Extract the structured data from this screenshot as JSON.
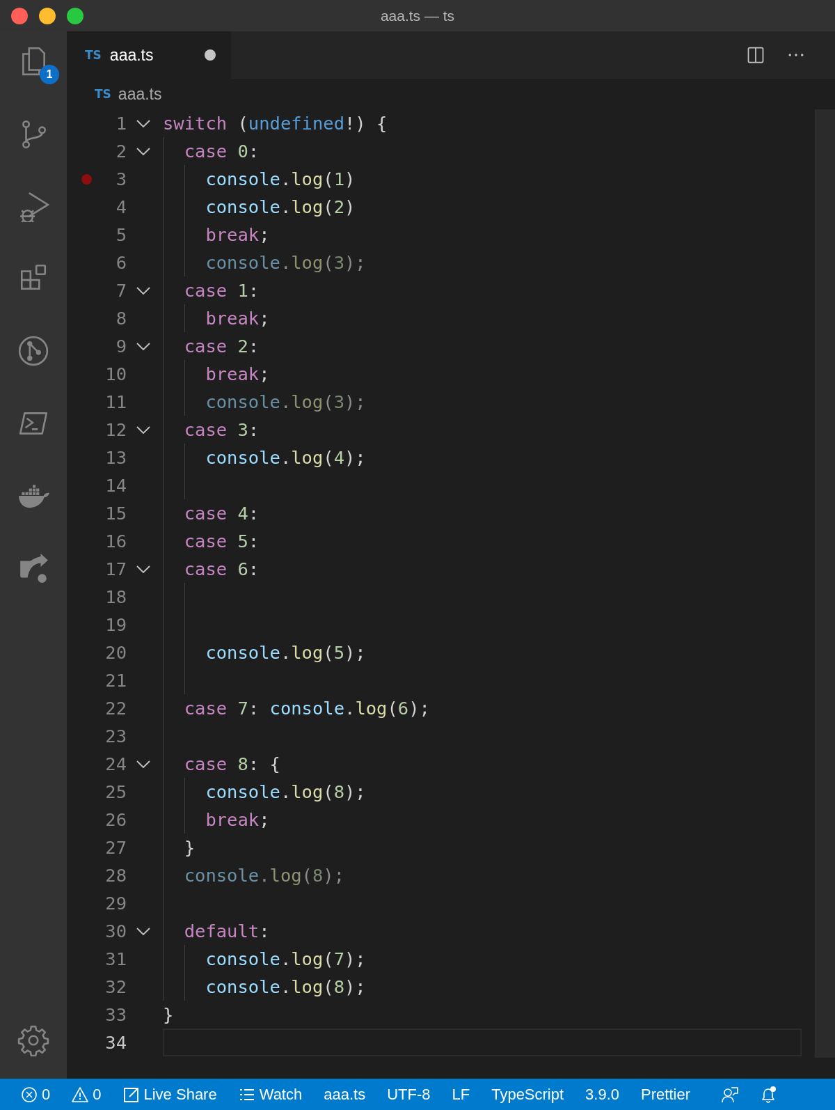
{
  "window": {
    "title": "aaa.ts — ts"
  },
  "activity_bar": {
    "items": [
      {
        "kind": "explorer",
        "badge": "1"
      },
      {
        "kind": "source-control"
      },
      {
        "kind": "run-debug"
      },
      {
        "kind": "extensions"
      },
      {
        "kind": "git-graph"
      },
      {
        "kind": "terminal"
      },
      {
        "kind": "docker"
      },
      {
        "kind": "share"
      }
    ],
    "bottom": [
      {
        "kind": "settings"
      }
    ]
  },
  "tabs": [
    {
      "type_label": "TS",
      "label": "aaa.ts",
      "selected": true,
      "dirty": true
    }
  ],
  "breadcrumb": {
    "type_label": "TS",
    "file": "aaa.ts"
  },
  "editor": {
    "lines": [
      {
        "number": "1",
        "breakpoint": false,
        "faded": false,
        "current": false,
        "tokens": [
          {
            "kind": "kw",
            "text": "switch"
          },
          {
            "kind": "p",
            "text": " ("
          },
          {
            "kind": "const",
            "text": "undefined"
          },
          {
            "kind": "p",
            "text": "!) {"
          }
        ],
        "children": [
          {
            "number": "2",
            "breakpoint": false,
            "faded": false,
            "current": false,
            "tokens": [
              {
                "kind": "kw",
                "text": "case"
              },
              {
                "kind": "num",
                "text": " 0"
              },
              {
                "kind": "p",
                "text": ":"
              }
            ],
            "children": [
              {
                "number": "3",
                "breakpoint": true,
                "faded": false,
                "current": false,
                "tokens": [
                  {
                    "kind": "var",
                    "text": "console"
                  },
                  {
                    "kind": "p",
                    "text": "."
                  },
                  {
                    "kind": "fn",
                    "text": "log"
                  },
                  {
                    "kind": "p",
                    "text": "("
                  },
                  {
                    "kind": "num",
                    "text": "1"
                  },
                  {
                    "kind": "p",
                    "text": ")"
                  }
                ]
              },
              {
                "number": "4",
                "breakpoint": false,
                "faded": false,
                "current": false,
                "tokens": [
                  {
                    "kind": "var",
                    "text": "console"
                  },
                  {
                    "kind": "p",
                    "text": "."
                  },
                  {
                    "kind": "fn",
                    "text": "log"
                  },
                  {
                    "kind": "p",
                    "text": "("
                  },
                  {
                    "kind": "num",
                    "text": "2"
                  },
                  {
                    "kind": "p",
                    "text": ")"
                  }
                ]
              },
              {
                "number": "5",
                "breakpoint": false,
                "faded": false,
                "current": false,
                "tokens": [
                  {
                    "kind": "kw",
                    "text": "break"
                  },
                  {
                    "kind": "p",
                    "text": ";"
                  }
                ]
              },
              {
                "number": "6",
                "breakpoint": false,
                "faded": true,
                "current": false,
                "tokens": [
                  {
                    "kind": "var",
                    "text": "console"
                  },
                  {
                    "kind": "p",
                    "text": "."
                  },
                  {
                    "kind": "fn",
                    "text": "log"
                  },
                  {
                    "kind": "p",
                    "text": "("
                  },
                  {
                    "kind": "num",
                    "text": "3"
                  },
                  {
                    "kind": "p",
                    "text": ");"
                  }
                ]
              }
            ]
          },
          {
            "number": "7",
            "breakpoint": false,
            "faded": false,
            "current": false,
            "tokens": [
              {
                "kind": "kw",
                "text": "case"
              },
              {
                "kind": "num",
                "text": " 1"
              },
              {
                "kind": "p",
                "text": ":"
              }
            ],
            "children": [
              {
                "number": "8",
                "breakpoint": false,
                "faded": false,
                "current": false,
                "tokens": [
                  {
                    "kind": "kw",
                    "text": "break"
                  },
                  {
                    "kind": "p",
                    "text": ";"
                  }
                ]
              }
            ]
          },
          {
            "number": "9",
            "breakpoint": false,
            "faded": false,
            "current": false,
            "tokens": [
              {
                "kind": "kw",
                "text": "case"
              },
              {
                "kind": "num",
                "text": " 2"
              },
              {
                "kind": "p",
                "text": ":"
              }
            ],
            "children": [
              {
                "number": "10",
                "breakpoint": false,
                "faded": false,
                "current": false,
                "tokens": [
                  {
                    "kind": "kw",
                    "text": "break"
                  },
                  {
                    "kind": "p",
                    "text": ";"
                  }
                ]
              },
              {
                "number": "11",
                "breakpoint": false,
                "faded": true,
                "current": false,
                "tokens": [
                  {
                    "kind": "var",
                    "text": "console"
                  },
                  {
                    "kind": "p",
                    "text": "."
                  },
                  {
                    "kind": "fn",
                    "text": "log"
                  },
                  {
                    "kind": "p",
                    "text": "("
                  },
                  {
                    "kind": "num",
                    "text": "3"
                  },
                  {
                    "kind": "p",
                    "text": ");"
                  }
                ]
              }
            ]
          },
          {
            "number": "12",
            "breakpoint": false,
            "faded": false,
            "current": false,
            "tokens": [
              {
                "kind": "kw",
                "text": "case"
              },
              {
                "kind": "num",
                "text": " 3"
              },
              {
                "kind": "p",
                "text": ":"
              }
            ],
            "children": [
              {
                "number": "13",
                "breakpoint": false,
                "faded": false,
                "current": false,
                "tokens": [
                  {
                    "kind": "var",
                    "text": "console"
                  },
                  {
                    "kind": "p",
                    "text": "."
                  },
                  {
                    "kind": "fn",
                    "text": "log"
                  },
                  {
                    "kind": "p",
                    "text": "("
                  },
                  {
                    "kind": "num",
                    "text": "4"
                  },
                  {
                    "kind": "p",
                    "text": ");"
                  }
                ]
              },
              {
                "number": "14",
                "breakpoint": false,
                "current": false
              }
            ]
          },
          {
            "number": "15",
            "breakpoint": false,
            "faded": false,
            "current": false,
            "tokens": [
              {
                "kind": "kw",
                "text": "case"
              },
              {
                "kind": "num",
                "text": " 4"
              },
              {
                "kind": "p",
                "text": ":"
              }
            ]
          },
          {
            "number": "16",
            "breakpoint": false,
            "faded": false,
            "current": false,
            "tokens": [
              {
                "kind": "kw",
                "text": "case"
              },
              {
                "kind": "num",
                "text": " 5"
              },
              {
                "kind": "p",
                "text": ":"
              }
            ]
          },
          {
            "number": "17",
            "breakpoint": false,
            "faded": false,
            "current": false,
            "tokens": [
              {
                "kind": "kw",
                "text": "case"
              },
              {
                "kind": "num",
                "text": " 6"
              },
              {
                "kind": "p",
                "text": ":"
              }
            ],
            "children": [
              {
                "number": "18",
                "breakpoint": false,
                "current": false
              },
              {
                "number": "19",
                "breakpoint": false,
                "current": false
              },
              {
                "number": "20",
                "breakpoint": false,
                "faded": false,
                "current": false,
                "tokens": [
                  {
                    "kind": "var",
                    "text": "console"
                  },
                  {
                    "kind": "p",
                    "text": "."
                  },
                  {
                    "kind": "fn",
                    "text": "log"
                  },
                  {
                    "kind": "p",
                    "text": "("
                  },
                  {
                    "kind": "num",
                    "text": "5"
                  },
                  {
                    "kind": "p",
                    "text": ");"
                  }
                ]
              },
              {
                "number": "21",
                "breakpoint": false,
                "current": false
              }
            ]
          },
          {
            "number": "22",
            "breakpoint": false,
            "faded": false,
            "current": false,
            "tokens": [
              {
                "kind": "kw",
                "text": "case"
              },
              {
                "kind": "num",
                "text": " 7"
              },
              {
                "kind": "p",
                "text": ": "
              },
              {
                "kind": "var",
                "text": "console"
              },
              {
                "kind": "p",
                "text": "."
              },
              {
                "kind": "fn",
                "text": "log"
              },
              {
                "kind": "p",
                "text": "("
              },
              {
                "kind": "num",
                "text": "6"
              },
              {
                "kind": "p",
                "text": ");"
              }
            ]
          },
          {
            "number": "23",
            "breakpoint": false,
            "current": false
          },
          {
            "number": "24",
            "breakpoint": false,
            "faded": false,
            "current": false,
            "tokens": [
              {
                "kind": "kw",
                "text": "case"
              },
              {
                "kind": "num",
                "text": " 8"
              },
              {
                "kind": "p",
                "text": ": {"
              }
            ],
            "children": [
              {
                "number": "25",
                "breakpoint": false,
                "faded": false,
                "current": false,
                "tokens": [
                  {
                    "kind": "var",
                    "text": "console"
                  },
                  {
                    "kind": "p",
                    "text": "."
                  },
                  {
                    "kind": "fn",
                    "text": "log"
                  },
                  {
                    "kind": "p",
                    "text": "("
                  },
                  {
                    "kind": "num",
                    "text": "8"
                  },
                  {
                    "kind": "p",
                    "text": ");"
                  }
                ]
              },
              {
                "number": "26",
                "breakpoint": false,
                "faded": false,
                "current": false,
                "tokens": [
                  {
                    "kind": "kw",
                    "text": "break"
                  },
                  {
                    "kind": "p",
                    "text": ";"
                  }
                ]
              }
            ]
          },
          {
            "number": "27",
            "breakpoint": false,
            "faded": false,
            "current": false,
            "tokens": [
              {
                "kind": "p",
                "text": "}"
              }
            ]
          },
          {
            "number": "28",
            "breakpoint": false,
            "faded": true,
            "current": false,
            "tokens": [
              {
                "kind": "var",
                "text": "console"
              },
              {
                "kind": "p",
                "text": "."
              },
              {
                "kind": "fn",
                "text": "log"
              },
              {
                "kind": "p",
                "text": "("
              },
              {
                "kind": "num",
                "text": "8"
              },
              {
                "kind": "p",
                "text": ");"
              }
            ]
          },
          {
            "number": "29",
            "breakpoint": false,
            "current": false
          },
          {
            "number": "30",
            "breakpoint": false,
            "faded": false,
            "current": false,
            "tokens": [
              {
                "kind": "kw",
                "text": "default"
              },
              {
                "kind": "p",
                "text": ":"
              }
            ],
            "children": [
              {
                "number": "31",
                "breakpoint": false,
                "faded": false,
                "current": false,
                "tokens": [
                  {
                    "kind": "var",
                    "text": "console"
                  },
                  {
                    "kind": "p",
                    "text": "."
                  },
                  {
                    "kind": "fn",
                    "text": "log"
                  },
                  {
                    "kind": "p",
                    "text": "("
                  },
                  {
                    "kind": "num",
                    "text": "7"
                  },
                  {
                    "kind": "p",
                    "text": ");"
                  }
                ]
              },
              {
                "number": "32",
                "breakpoint": false,
                "faded": false,
                "current": false,
                "tokens": [
                  {
                    "kind": "var",
                    "text": "console"
                  },
                  {
                    "kind": "p",
                    "text": "."
                  },
                  {
                    "kind": "fn",
                    "text": "log"
                  },
                  {
                    "kind": "p",
                    "text": "("
                  },
                  {
                    "kind": "num",
                    "text": "8"
                  },
                  {
                    "kind": "p",
                    "text": ");"
                  }
                ]
              }
            ]
          }
        ]
      },
      {
        "number": "33",
        "breakpoint": false,
        "faded": false,
        "current": false,
        "tokens": [
          {
            "kind": "p",
            "text": "}"
          }
        ]
      },
      {
        "number": "34",
        "breakpoint": false,
        "current": true
      }
    ]
  },
  "status_bar": {
    "items": [
      {
        "kind": "errors",
        "text": "0"
      },
      {
        "kind": "warnings",
        "text": "0"
      },
      {
        "kind": "live-share",
        "text": "Live Share"
      },
      {
        "kind": "watch",
        "text": "Watch"
      },
      {
        "kind": "text",
        "text": "aaa.ts"
      },
      {
        "kind": "text",
        "text": "UTF-8"
      },
      {
        "kind": "text",
        "text": "LF"
      },
      {
        "kind": "text",
        "text": "TypeScript"
      },
      {
        "kind": "text",
        "text": "3.9.0"
      },
      {
        "kind": "text",
        "text": "Prettier"
      },
      {
        "kind": "feedback"
      },
      {
        "kind": "notifications"
      }
    ]
  }
}
